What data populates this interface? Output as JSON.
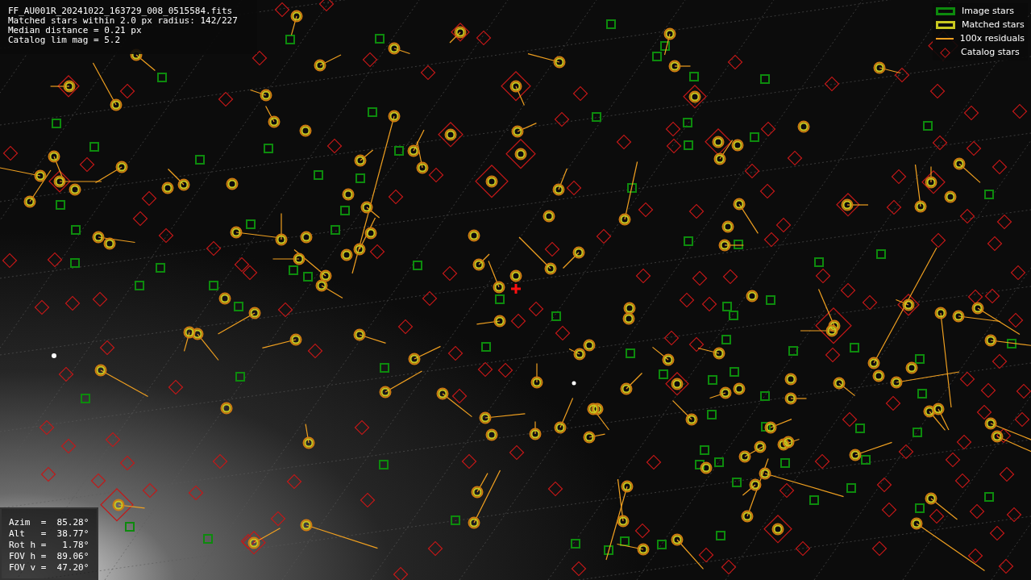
{
  "file_info": {
    "lines": [
      "FF_AU001R_20241022_163729_008_0515584.fits",
      "Matched stars within 2.0 px radius: 142/227",
      "Median distance = 0.21 px",
      "Catalog lim mag = 5.2"
    ]
  },
  "legend": {
    "items": [
      {
        "kind": "image",
        "label": "Image stars"
      },
      {
        "kind": "matched",
        "label": "Matched stars"
      },
      {
        "kind": "residual",
        "label": "100x residuals"
      },
      {
        "kind": "catalog",
        "label": "Catalog stars"
      }
    ]
  },
  "pointing": {
    "rows": [
      "Azim  =  85.28°",
      "Alt   =  38.77°",
      "Rot h =   1.78°",
      "FOV h =  89.06°",
      "FOV v =  47.20°"
    ]
  }
}
